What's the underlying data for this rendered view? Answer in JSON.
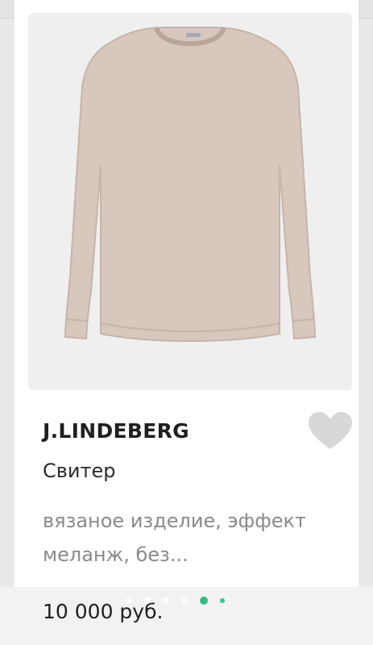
{
  "product": {
    "brand": "J.LINDEBERG",
    "title": "Свитер",
    "description": "вязаное изделие, эффект меланж, без...",
    "price": "10 000 руб.",
    "image_alt": "sweater-image"
  },
  "ui": {
    "icons": {
      "close": "close-icon",
      "favorite": "heart-icon"
    },
    "colors": {
      "accent": "#2fbf86",
      "favorite": "#d8d8d8",
      "sweater": "#d8c7bd"
    },
    "carousel": {
      "count": 6,
      "active_index": 4
    }
  }
}
